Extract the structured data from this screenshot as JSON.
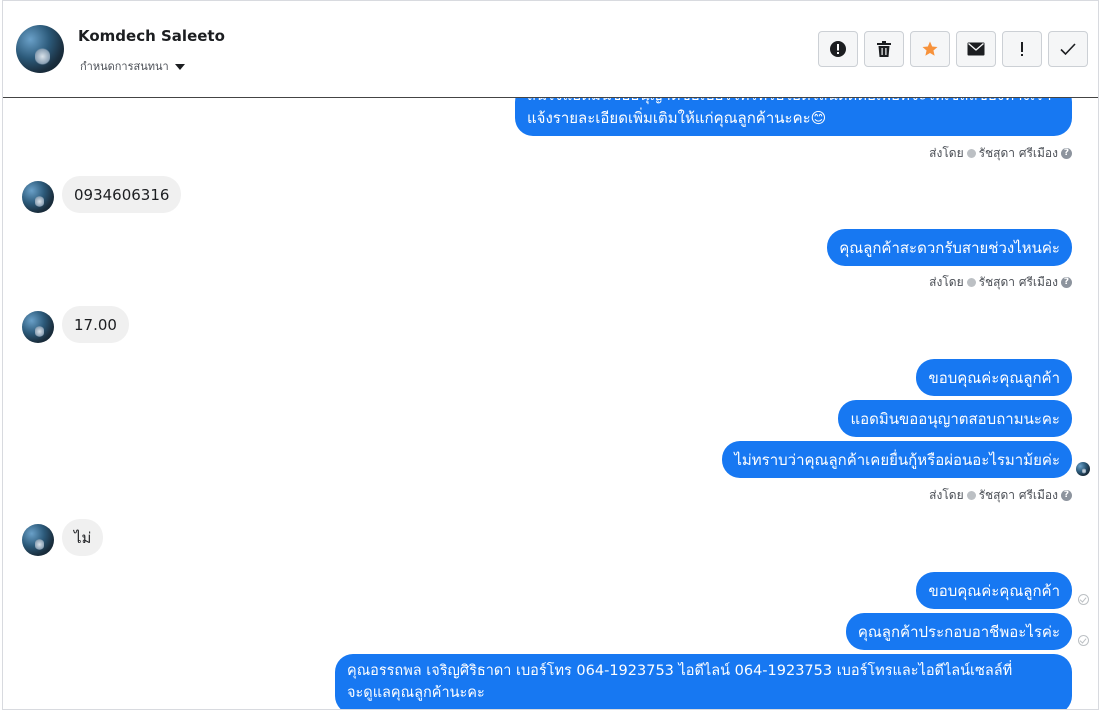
{
  "header": {
    "name": "Komdech Saleeto",
    "subtitle": "กำหนดการสนทนา"
  },
  "toolbar": {
    "buttons": [
      {
        "icon": "alert-circle-icon"
      },
      {
        "icon": "trash-icon"
      },
      {
        "icon": "star-icon",
        "color": "#f7923b"
      },
      {
        "icon": "envelope-icon"
      },
      {
        "icon": "exclamation-icon"
      },
      {
        "icon": "checkmark-icon"
      }
    ]
  },
  "messages": {
    "m1_line1": "สนใจแอดมินขออนุญาตขอเบอร์โทรหรือไอดีไลน์ติดต่อเพื่อที่จะให้เซลล์ของทางเรา",
    "m1_line2": "แจ้งรายละเอียดเพิ่มเติมให้แก่คุณลูกค้านะคะ😊",
    "meta1_prefix": "ส่งโดย",
    "meta1_agent": "รัชสุดา ศรีเมือง",
    "m2": "0934606316",
    "m3": "คุณลูกค้าสะดวกรับสายช่วงไหนค่ะ",
    "meta2_prefix": "ส่งโดย",
    "meta2_agent": "รัชสุดา ศรีเมือง",
    "m4": "17.00",
    "m5": "ขอบคุณค่ะคุณลูกค้า",
    "m6": "แอดมินขออนุญาตสอบถามนะคะ",
    "m7": "ไม่ทราบว่าคุณลูกค้าเคยยื่นกู้หรือผ่อนอะไรมาม้ยค่ะ",
    "meta3_prefix": "ส่งโดย",
    "meta3_agent": "รัชสุดา ศรีเมือง",
    "m8": "ไม่",
    "m9": "ขอบคุณค่ะคุณลูกค้า",
    "m10": "คุณลูกค้าประกอบอาชีพอะไรค่ะ",
    "m11_line1": "คุณอรรถพล เจริญศิริธาดา      เบอร์โทร 064-1923753 ไอดีไลน์ 064-1923753   เบอร์โทรและไอดีไลน์เซลล์ที่",
    "m11_line2": "จะดูแลคุณลูกค้านะคะ"
  },
  "colors": {
    "outgoing": "#1778f2",
    "incoming": "#f0f0f0",
    "star": "#f7923b"
  }
}
